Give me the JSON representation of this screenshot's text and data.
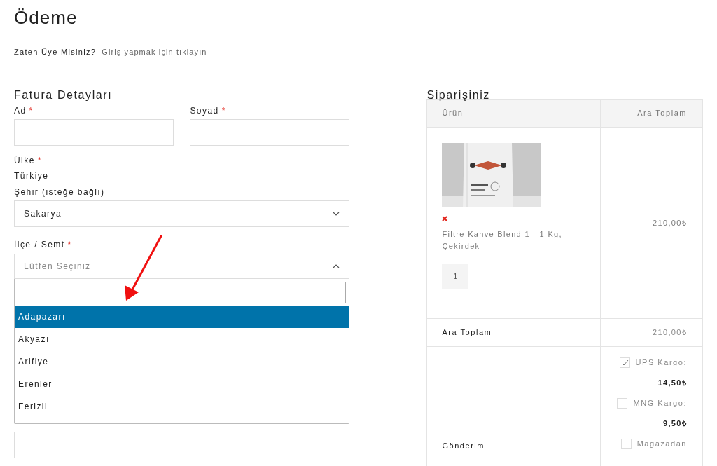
{
  "page": {
    "title": "Ödeme"
  },
  "login_prompt": {
    "question": "Zaten Üye Misiniz?",
    "link": "Giriş yapmak için tıklayın"
  },
  "billing": {
    "title": "Fatura Detayları",
    "first_name": {
      "label": "Ad",
      "required_mark": "*"
    },
    "last_name": {
      "label": "Soyad",
      "required_mark": "*"
    },
    "country": {
      "label": "Ülke",
      "required_mark": "*",
      "value": "Türkiye"
    },
    "city": {
      "label": "Şehir (isteğe bağlı)",
      "value": "Sakarya",
      "expanded": false
    },
    "district": {
      "label": "İlçe / Semt",
      "required_mark": "*",
      "placeholder": "Lütfen Seçiniz",
      "expanded": true,
      "options": [
        {
          "label": "Adapazarı",
          "selected": true
        },
        {
          "label": "Akyazı",
          "selected": false
        },
        {
          "label": "Arifiye",
          "selected": false
        },
        {
          "label": "Erenler",
          "selected": false
        },
        {
          "label": "Ferizli",
          "selected": false
        }
      ]
    }
  },
  "order": {
    "title": "Siparişiniz",
    "columns": [
      "Ürün",
      "Ara Toplam"
    ],
    "items": [
      {
        "name": "Filtre Kahve Blend 1 - 1 Kg, Çekirdek",
        "quantity": "1",
        "total": "210,00₺"
      }
    ],
    "subtotal": {
      "label": "Ara Toplam",
      "value": "210,00₺"
    },
    "shipping": {
      "label": "Gönderim",
      "options": [
        {
          "label": "UPS Kargo:",
          "price": "14,50₺",
          "checked": true
        },
        {
          "label": "MNG Kargo:",
          "price": "9,50₺",
          "checked": false
        },
        {
          "label": "Mağazadan",
          "checked": false
        }
      ]
    }
  }
}
